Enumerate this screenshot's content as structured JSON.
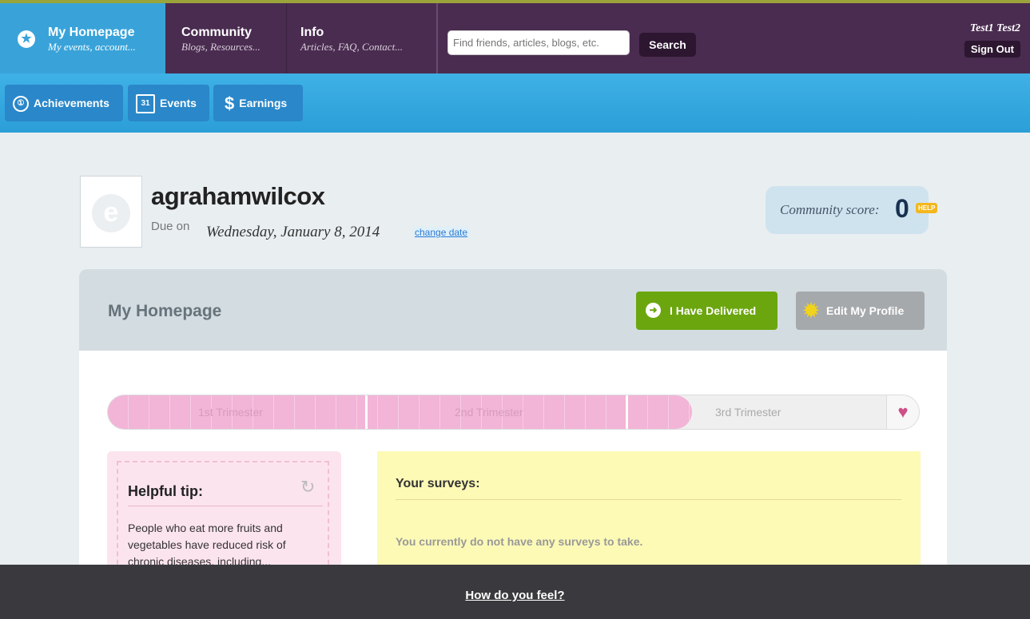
{
  "nav": {
    "tabs": [
      {
        "title": "My Homepage",
        "subtitle": "My events, account..."
      },
      {
        "title": "Community",
        "subtitle": "Blogs, Resources..."
      },
      {
        "title": "Info",
        "subtitle": "Articles, FAQ, Contact..."
      }
    ],
    "home_icon": "star-icon",
    "search": {
      "placeholder": "Find friends, articles, blogs, etc.",
      "button_label": "Search"
    },
    "user_name": "Test1 Test2",
    "sign_out": "Sign Out"
  },
  "subnav": {
    "items": [
      {
        "label": "Achievements",
        "icon": "medal-icon",
        "icon_glyph": "①"
      },
      {
        "label": "Events",
        "icon": "calendar-icon",
        "icon_glyph": "31"
      },
      {
        "label": "Earnings",
        "icon": "dollar-icon",
        "icon_glyph": "$"
      }
    ]
  },
  "profile": {
    "username": "agrahamwilcox",
    "due_label": "Due on",
    "due_date": "Wednesday, January 8, 2014",
    "change_date": "change date",
    "community_score_label": "Community score:",
    "community_score": "0",
    "help_badge": "HELP"
  },
  "panel": {
    "title": "My Homepage",
    "delivered_button": "I Have Delivered",
    "edit_profile_button": "Edit My Profile"
  },
  "pregnancy": {
    "trimesters": [
      "1st Trimester",
      "2nd Trimester",
      "3rd Trimester"
    ],
    "progress_fraction": 0.75,
    "heart_icon": "heart-icon",
    "heart_glyph": "♥"
  },
  "tip": {
    "title": "Helpful tip:",
    "refresh_glyph": "↻",
    "text": "People who eat more fruits and vegetables have reduced risk of chronic diseases, including..."
  },
  "surveys": {
    "title": "Your surveys:",
    "empty_text": "You currently do not have any surveys to take."
  },
  "footer": {
    "link": "How do you feel?"
  },
  "colors": {
    "topbar": "#4a2c50",
    "active_tab": "#39a3d9",
    "subnav": "#2c9ed8",
    "delivered": "#6ba60e",
    "progress_pink": "#f2b4d7",
    "survey_bg": "#fdfab6",
    "footer": "#3a3a3e"
  }
}
